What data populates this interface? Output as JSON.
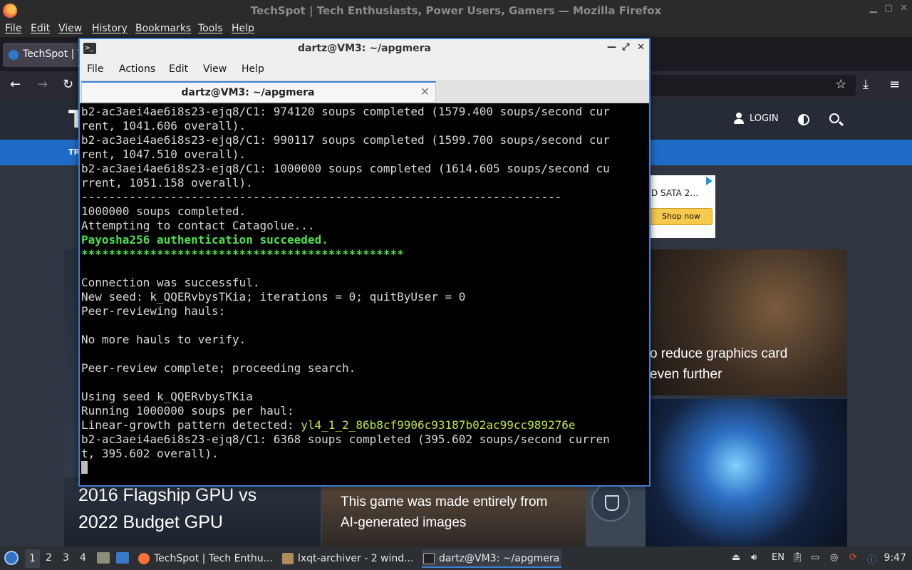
{
  "firefox": {
    "window_title": "TechSpot | Tech Enthusiasts, Power Users, Gamers — Mozilla Firefox",
    "menu": [
      "File",
      "Edit",
      "View",
      "History",
      "Bookmarks",
      "Tools",
      "Help"
    ],
    "tab_label": "TechSpot | T"
  },
  "page": {
    "header_logo_letter": "T",
    "login_label": "LOGIN",
    "nav_text": "TR",
    "ad": {
      "text": "D SATA 2…",
      "button": "Shop now"
    },
    "articles": {
      "gpu_title": "o reduce graphics card\neven further",
      "flagship_title": "2016 Flagship GPU vs\n2022 Budget GPU",
      "ai_title": "This game was made entirely from\nAI-generated images"
    }
  },
  "terminal": {
    "window_title": "dartz@VM3: ~/apgmera",
    "menu": [
      "File",
      "Actions",
      "Edit",
      "View",
      "Help"
    ],
    "tab_title": "dartz@VM3: ~/apgmera",
    "lines": [
      {
        "text": "b2-ac3aei4ae6i8s23-ejq8/C1: 974120 soups completed (1579.400 soups/second cur",
        "style": ""
      },
      {
        "text": "rent, 1041.606 overall).",
        "style": ""
      },
      {
        "text": "b2-ac3aei4ae6i8s23-ejq8/C1: 990117 soups completed (1599.700 soups/second cur",
        "style": ""
      },
      {
        "text": "rent, 1047.510 overall).",
        "style": ""
      },
      {
        "text": "b2-ac3aei4ae6i8s23-ejq8/C1: 1000000 soups completed (1614.605 soups/second cu",
        "style": ""
      },
      {
        "text": "rrent, 1051.158 overall).",
        "style": ""
      },
      {
        "text": "----------------------------------------------------------------------",
        "style": ""
      },
      {
        "text": "1000000 soups completed.",
        "style": ""
      },
      {
        "text": "Attempting to contact Catagolue...",
        "style": ""
      },
      {
        "text": "Payosha256 authentication succeeded.",
        "style": "g"
      },
      {
        "text": "***********************************************",
        "style": "g"
      },
      {
        "text": "",
        "style": ""
      },
      {
        "text": "Connection was successful.",
        "style": ""
      },
      {
        "text": "New seed: k_QQERvbysTKia; iterations = 0; quitByUser = 0",
        "style": ""
      },
      {
        "text": "Peer-reviewing hauls:",
        "style": ""
      },
      {
        "text": "",
        "style": ""
      },
      {
        "text": "No more hauls to verify.",
        "style": ""
      },
      {
        "text": "",
        "style": ""
      },
      {
        "text": "Peer-review complete; proceeding search.",
        "style": ""
      },
      {
        "text": "",
        "style": ""
      },
      {
        "text": "Using seed k_QQERvbysTKia",
        "style": ""
      },
      {
        "text": "Running 1000000 soups per haul:",
        "style": ""
      },
      {
        "text": "Linear-growth pattern detected: ",
        "style": "",
        "highlight": "yl4_1_2_86b8cf9906c93187b02ac99cc989276e"
      },
      {
        "text": "b2-ac3aei4ae6i8s23-ejq8/C1: 6368 soups completed (395.602 soups/second curren",
        "style": ""
      },
      {
        "text": "t, 395.602 overall).",
        "style": ""
      }
    ]
  },
  "taskbar": {
    "desktops": [
      "1",
      "2",
      "3",
      "4"
    ],
    "tasks": [
      {
        "label": "TechSpot | Tech Enthu...",
        "icon": "firefox-icon"
      },
      {
        "label": "lxqt-archiver - 2 wind...",
        "icon": "archiver-icon"
      },
      {
        "label": "dartz@VM3: ~/apgmera",
        "icon": "terminal-icon"
      }
    ],
    "keyboard_layout": "EN",
    "clock": "9:47"
  },
  "colors": {
    "accent": "#3d7fd0",
    "terminal_green": "#4fe04f",
    "terminal_yellow": "#c3e545",
    "techspot_blue": "#1f6cc7"
  }
}
